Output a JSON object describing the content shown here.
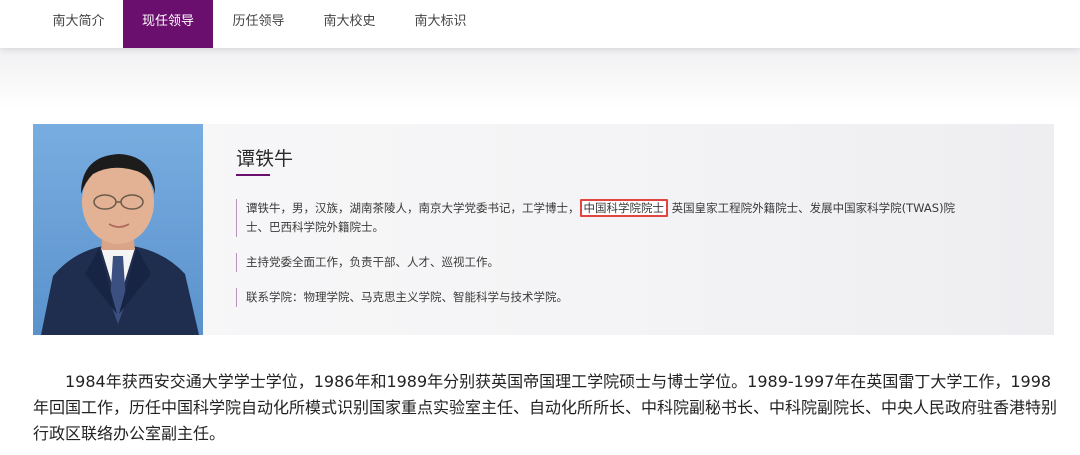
{
  "nav": {
    "items": [
      {
        "label": "南大简介",
        "active": false
      },
      {
        "label": "现任领导",
        "active": true
      },
      {
        "label": "历任领导",
        "active": false
      },
      {
        "label": "南大校史",
        "active": false
      },
      {
        "label": "南大标识",
        "active": false
      }
    ]
  },
  "profile": {
    "name": "谭铁牛",
    "bio_pre": "谭铁牛，男，汉族，湖南茶陵人，南京大学党委书记，工学博士，",
    "bio_highlight": "中国科学院院士",
    "bio_post_line1": " 英国皇家工程院外籍院士、发展中国家科学院(TWAS)院",
    "bio_post_line2": "士、巴西科学院外籍院士。",
    "duty": "主持党委全面工作，负责干部、人才、巡视工作。",
    "contact": "联系学院：物理学院、马克思主义学院、智能科学与技术学院。"
  },
  "article": {
    "paragraph": "1984年获西安交通大学学士学位，1986年和1989年分别获英国帝国理工学院硕士与博士学位。1989-1997年在英国雷丁大学工作，1998年回国工作，历任中国科学院自动化所模式识别国家重点实验室主任、自动化所所长、中科院副秘书长、中科院副院长、中央人民政府驻香港特别行政区联络办公室副主任。"
  },
  "colors": {
    "accent": "#6b0f6e",
    "highlight_border": "#e0463f"
  }
}
